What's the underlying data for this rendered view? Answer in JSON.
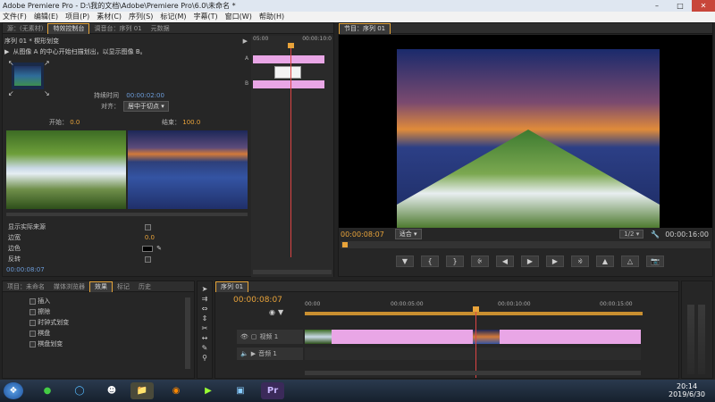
{
  "window": {
    "title": "Adobe Premiere Pro - D:\\我的文档\\Adobe\\Premiere Pro\\6.0\\未命名 *"
  },
  "menu": [
    "文件(F)",
    "编辑(E)",
    "项目(P)",
    "素材(C)",
    "序列(S)",
    "标记(M)",
    "字幕(T)",
    "窗口(W)",
    "帮助(H)"
  ],
  "effects_panel": {
    "tabs": [
      "源：(无素材)",
      "特效控制台",
      "调音台：序列 01",
      "元数据"
    ],
    "sequence_label": "序列 01 * 楔形划变",
    "description": "从图像 A 的中心开始扫描划出，以显示图像 B。",
    "duration_label": "持续时间",
    "duration_value": "00:00:02:00",
    "align_label": "对齐：",
    "align_value": "居中于切点",
    "start_label": "开始：",
    "start_value": "0.0",
    "end_label": "结束：",
    "end_value": "100.0",
    "mini_timeline_start": "05:00",
    "mini_timeline_end": "00:00:10:0",
    "a_label": "A",
    "b_label": "B",
    "show_actual_label": "显示实际来源",
    "border_width_label": "边宽",
    "border_width_value": "0.0",
    "border_color_label": "边色",
    "reverse_label": "反转",
    "bottom_time": "00:00:08:07"
  },
  "program_monitor": {
    "tab": "节目：序列 01",
    "timecode": "00:00:08:07",
    "fit": "适合",
    "page": "1/2",
    "end_time": "00:00:16:00"
  },
  "project_panel": {
    "tabs": [
      "项目：未命名",
      "媒体浏览器",
      "效果",
      "标记",
      "历史"
    ],
    "items": [
      "插入",
      "擦除",
      "时钟式划变",
      "棋盘",
      "棋盘划变"
    ]
  },
  "timeline": {
    "tab": "序列 01",
    "timecode": "00:00:08:07",
    "ruler": [
      "00:00",
      "00:00:05:00",
      "00:00:10:00",
      "00:00:15:00"
    ],
    "audio_track": "音频 1",
    "video_track": "视频 1"
  },
  "taskbar": {
    "time": "20:14",
    "date": "2019/6/30",
    "premiere_icon": "Pr"
  },
  "colors": {
    "accent_orange": "#e8a33a",
    "clip_pink": "#e9a6e6",
    "playhead_red": "#d44"
  }
}
